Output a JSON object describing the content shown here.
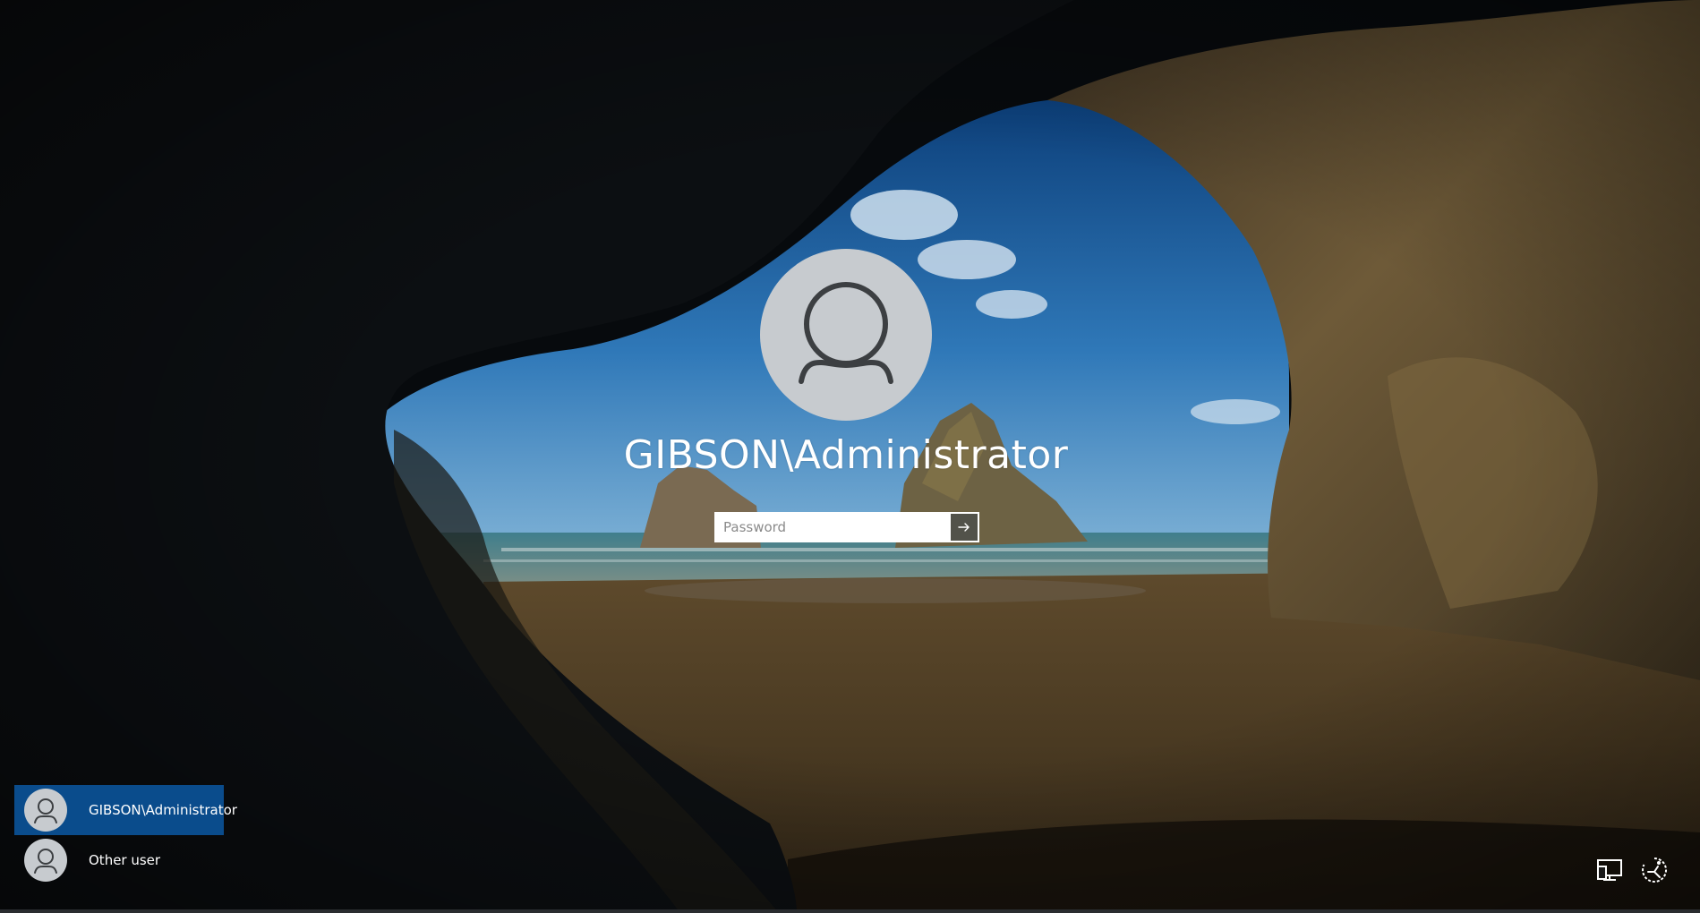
{
  "login": {
    "username": "GIBSON\\Administrator",
    "password_placeholder": "Password",
    "password_value": ""
  },
  "user_list": [
    {
      "name": "GIBSON\\Administrator",
      "selected": true
    },
    {
      "name": "Other user",
      "selected": false
    }
  ],
  "tray": {
    "network_icon": "network-icon",
    "ease_of_access_icon": "ease-of-access-icon"
  },
  "colors": {
    "selected_user_bg": "#0a4c8c",
    "avatar_bg": "#c7cbcf",
    "avatar_glyph": "#3c3f42"
  }
}
